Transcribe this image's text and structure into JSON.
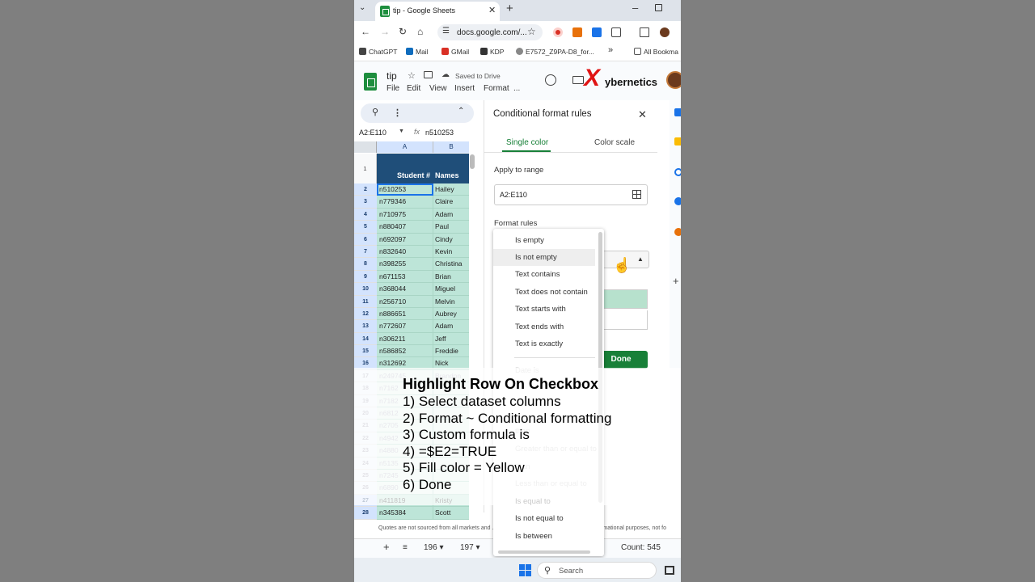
{
  "browser": {
    "tab_title": "tip - Google Sheets",
    "url": "docs.google.com/...",
    "bookmarks": [
      "ChatGPT",
      "Mail",
      "GMail",
      "KDP",
      "E7572_Z9PA-D8_for...",
      "All Bookma"
    ]
  },
  "sheets": {
    "doc_title": "tip",
    "saved_status": "Saved to Drive",
    "menu": [
      "File",
      "Edit",
      "View",
      "Insert",
      "Format",
      "..."
    ],
    "watermark_text": "ybernetics",
    "watermark_x": "X",
    "name_box": "A2:E110",
    "fx_label": "fx",
    "formula_value": "n510253",
    "columns": [
      "A",
      "B"
    ],
    "header_row_number": "1",
    "header_student": "Student #",
    "header_names": "Names",
    "rows": [
      {
        "n": "2",
        "id": "n510253",
        "name": "Hailey"
      },
      {
        "n": "3",
        "id": "n779346",
        "name": "Claire"
      },
      {
        "n": "4",
        "id": "n710975",
        "name": "Adam"
      },
      {
        "n": "5",
        "id": "n880407",
        "name": "Paul"
      },
      {
        "n": "6",
        "id": "n692097",
        "name": "Cindy"
      },
      {
        "n": "7",
        "id": "n832640",
        "name": "Kevin"
      },
      {
        "n": "8",
        "id": "n398255",
        "name": "Christina"
      },
      {
        "n": "9",
        "id": "n671153",
        "name": "Brian"
      },
      {
        "n": "10",
        "id": "n368044",
        "name": "Miguel"
      },
      {
        "n": "11",
        "id": "n256710",
        "name": "Melvin"
      },
      {
        "n": "12",
        "id": "n886651",
        "name": "Aubrey"
      },
      {
        "n": "13",
        "id": "n772607",
        "name": "Adam"
      },
      {
        "n": "14",
        "id": "n306211",
        "name": "Jeff"
      },
      {
        "n": "15",
        "id": "n586852",
        "name": "Freddie"
      },
      {
        "n": "16",
        "id": "n312692",
        "name": "Nick"
      },
      {
        "n": "17",
        "id": "n249745",
        "name": "Brandon"
      },
      {
        "n": "18",
        "id": "n7162",
        "name": ""
      },
      {
        "n": "19",
        "id": "n7182",
        "name": ""
      },
      {
        "n": "20",
        "id": "n6812",
        "name": ""
      },
      {
        "n": "21",
        "id": "n2705",
        "name": ""
      },
      {
        "n": "22",
        "id": "n4942",
        "name": ""
      },
      {
        "n": "23",
        "id": "n4880",
        "name": ""
      },
      {
        "n": "24",
        "id": "n5135",
        "name": ""
      },
      {
        "n": "25",
        "id": "n7245",
        "name": ""
      },
      {
        "n": "26",
        "id": "n6890",
        "name": ""
      },
      {
        "n": "27",
        "id": "n411819",
        "name": "Kristy"
      },
      {
        "n": "28",
        "id": "n345384",
        "name": "Scott"
      }
    ],
    "disclaimer": "Quotes are not sourced from all markets and ... ation is provided 'as is' and solely for informational purposes, not fo",
    "bottom": {
      "zoom_a": "196",
      "zoom_b": "197",
      "count": "Count: 545"
    }
  },
  "panel": {
    "title": "Conditional format rules",
    "tab_single": "Single color",
    "tab_scale": "Color scale",
    "apply_label": "Apply to range",
    "range_value": "A2:E110",
    "rules_label": "Format rules",
    "done_label": "Done",
    "condition_options": [
      "Is empty",
      "Is not empty",
      "Text contains",
      "Text does not contain",
      "Text starts with",
      "Text ends with",
      "Text is exactly",
      "Date is",
      "than",
      "Greater than or equal to",
      "than",
      "Less than or equal to",
      "Is equal to",
      "Is not equal to",
      "Is between"
    ]
  },
  "overlay": {
    "title": "Highlight Row On Checkbox",
    "steps": [
      "1) Select dataset columns",
      "2) Format ~ Conditional formatting",
      "3) Custom formula is",
      "4) =$E2=TRUE",
      "5) Fill color = Yellow",
      "6) Done"
    ]
  },
  "taskbar": {
    "search_placeholder": "Search"
  },
  "colors": {
    "sheets_green": "#188038",
    "header_navy": "#1f4e79",
    "cell_teal": "#bde5d8",
    "watermark_red": "#e01414"
  }
}
